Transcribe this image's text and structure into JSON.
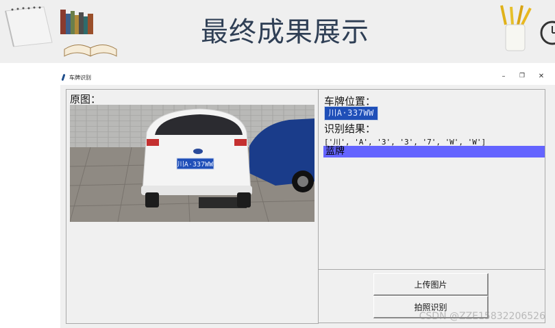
{
  "banner": {
    "title": "最终成果展示"
  },
  "window": {
    "title": "车牌识别",
    "minimize": "–",
    "restore": "❐",
    "close": "✕"
  },
  "left": {
    "original_label": "原图：",
    "plate_in_photo": "川A·337WW"
  },
  "right": {
    "position_label": "车牌位置：",
    "plate_text": "川A·337WW",
    "result_label": "识别结果：",
    "chars": "['川', 'A', '3', '3', '7', 'W', 'W']",
    "plate_color": "蓝牌"
  },
  "buttons": {
    "upload": "上传图片",
    "capture": "拍照识别"
  },
  "watermark": "CSDN @ZZE15832206526",
  "colors": {
    "plate_blue": "#1f4fb8",
    "highlight": "#6464ff",
    "banner_text": "#2f3f55"
  }
}
